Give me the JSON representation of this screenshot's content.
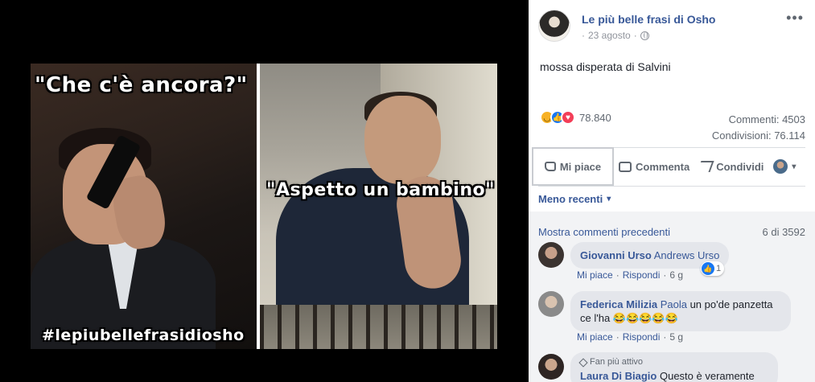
{
  "meme": {
    "caption_top": "\"Che c'è ancora?\"",
    "caption_middle": "\"Aspetto un bambino\"",
    "hashtag": "#lepiubellefrasidiosho"
  },
  "post": {
    "page_name": "Le più belle frasi di Osho",
    "date": "23 agosto",
    "separator": "·",
    "more_icon": "•••",
    "text": "mossa disperata di Salvini",
    "reactions_count": "78.840",
    "comments": "Commenti: 4503",
    "shares": "Condivisioni: 76.114"
  },
  "actions": {
    "like": "Mi piace",
    "comment": "Commenta",
    "share": "Condividi",
    "caret": "▾"
  },
  "comments_section": {
    "sort_label": "Meno recenti",
    "sort_caret": "▾",
    "show_previous": "Mostra commenti precedenti",
    "counter": "6 di 3592",
    "items": [
      {
        "author": "Giovanni Urso",
        "tag": "Andrews Urso",
        "text": "",
        "like": "Mi piace",
        "reply": "Rispondi",
        "dot": "·",
        "time": "6 g",
        "reactions": "1"
      },
      {
        "author": "Federica Milizia",
        "tag": "Paola",
        "text": " un po'de panzetta ce l'ha 😂😂😂😂😂",
        "like": "Mi piace",
        "reply": "Rispondi",
        "dot": "·",
        "time": "5 g"
      },
      {
        "badge": "Fan più attivo",
        "author": "Laura Di Biagio",
        "text": " Questo è veramente"
      }
    ]
  },
  "colors": {
    "link_blue": "#385898",
    "secondary_text": "#606770",
    "like_blue": "#1877f2",
    "love_red": "#f33e58",
    "haha_yellow": "#f7b125"
  }
}
